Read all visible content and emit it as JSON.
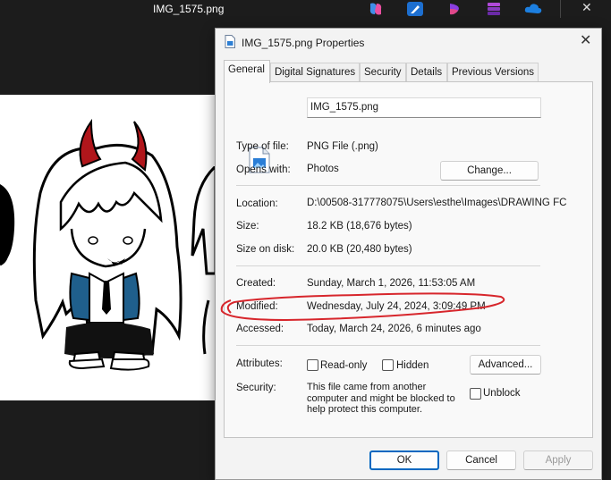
{
  "viewer": {
    "title": "IMG_1575.png",
    "toolbar_icons": [
      "copilot-icon",
      "edit-icon",
      "clipchamp-icon",
      "stack-icon",
      "onedrive-icon"
    ]
  },
  "dialog": {
    "title": "IMG_1575.png Properties",
    "tabs": [
      "General",
      "Digital Signatures",
      "Security",
      "Details",
      "Previous Versions"
    ],
    "file_name": "IMG_1575.png",
    "type_label": "Type of file:",
    "type_value": "PNG File (.png)",
    "opens_label": "Opens with:",
    "opens_value": "Photos",
    "change_button": "Change...",
    "location_label": "Location:",
    "location_value": "D:\\00508-317778075\\Users\\esthe\\Images\\DRAWING FC",
    "size_label": "Size:",
    "size_value": "18.2 KB (18,676 bytes)",
    "size_on_disk_label": "Size on disk:",
    "size_on_disk_value": "20.0 KB (20,480 bytes)",
    "created_label": "Created:",
    "created_value": "Sunday, March 1, 2026, 11:53:05 AM",
    "modified_label": "Modified:",
    "modified_value": "Wednesday, July 24, 2024, 3:09:49 PM",
    "accessed_label": "Accessed:",
    "accessed_value": "Today, March 24, 2026, 6 minutes ago",
    "attributes_label": "Attributes:",
    "readonly_label": "Read-only",
    "hidden_label": "Hidden",
    "advanced_button": "Advanced...",
    "security_label": "Security:",
    "security_text": "This file came from another computer and might be blocked to help protect this computer.",
    "unblock_label": "Unblock",
    "ok_button": "OK",
    "cancel_button": "Cancel",
    "apply_button": "Apply"
  },
  "colors": {
    "annotation_red": "#d7262c",
    "horn_red": "#b0161b",
    "jacket_blue": "#1f5f8c"
  }
}
